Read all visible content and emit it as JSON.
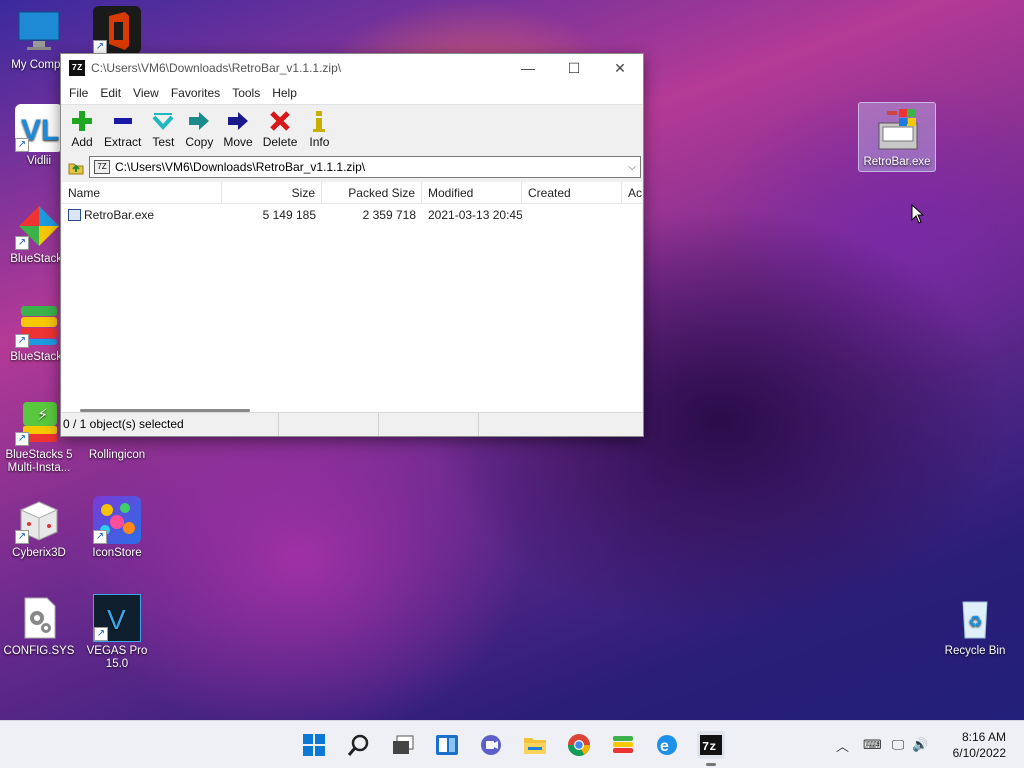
{
  "desktop": {
    "icons": [
      {
        "label": "My Compu",
        "icon": "monitor-icon"
      },
      {
        "label": "",
        "icon": "office-icon"
      },
      {
        "label": "Vidlii",
        "icon": "vidlii-icon"
      },
      {
        "label": "BlueStacks",
        "icon": "bluestacks-icon"
      },
      {
        "label": "BlueStacks",
        "icon": "bluestacks-layers-icon"
      },
      {
        "label": "BlueStacks 5 Multi-Insta...",
        "icon": "bluestacks-multi-icon"
      },
      {
        "label": "Rollingicon",
        "icon": "rollingicon-icon"
      },
      {
        "label": "Cyberix3D",
        "icon": "cyberix3d-icon"
      },
      {
        "label": "IconStore",
        "icon": "iconstore-icon"
      },
      {
        "label": "CONFIG.SYS",
        "icon": "config-file-icon"
      },
      {
        "label": "VEGAS Pro 15.0",
        "icon": "vegas-icon"
      },
      {
        "label": "RetroBar.exe",
        "icon": "retrobar-icon"
      },
      {
        "label": "Recycle Bin",
        "icon": "recycle-bin-icon"
      }
    ]
  },
  "window": {
    "title": "C:\\Users\\VM6\\Downloads\\RetroBar_v1.1.1.zip\\",
    "app_icon_text": "7Z",
    "controls": {
      "minimize": "—",
      "maximize": "☐",
      "close": "✕"
    },
    "menu": [
      "File",
      "Edit",
      "View",
      "Favorites",
      "Tools",
      "Help"
    ],
    "toolbar": [
      {
        "label": "Add",
        "icon": "add-icon",
        "color": "#1fa81f"
      },
      {
        "label": "Extract",
        "icon": "extract-icon",
        "color": "#1a1aa8"
      },
      {
        "label": "Test",
        "icon": "test-icon",
        "color": "#20b8c0"
      },
      {
        "label": "Copy",
        "icon": "copy-icon",
        "color": "#1a8a8a"
      },
      {
        "label": "Move",
        "icon": "move-icon",
        "color": "#1a1a8a"
      },
      {
        "label": "Delete",
        "icon": "delete-icon",
        "color": "#d81818"
      },
      {
        "label": "Info",
        "icon": "info-icon",
        "color": "#c8b000"
      }
    ],
    "address": "C:\\Users\\VM6\\Downloads\\RetroBar_v1.1.1.zip\\",
    "columns": [
      "Name",
      "Size",
      "Packed Size",
      "Modified",
      "Created",
      "Ac"
    ],
    "rows": [
      {
        "name": "RetroBar.exe",
        "size": "5 149 185",
        "packed": "2 359 718",
        "modified": "2021-03-13 20:45",
        "created": ""
      }
    ],
    "status": "0 / 1 object(s) selected"
  },
  "taskbar": {
    "items": [
      "start-icon",
      "search-icon",
      "task-view-icon",
      "widgets-icon",
      "chat-icon",
      "file-explorer-icon",
      "chrome-icon",
      "bluestacks-icon",
      "edge-icon",
      "7zip-icon"
    ],
    "time": "8:16 AM",
    "date": "6/10/2022"
  }
}
